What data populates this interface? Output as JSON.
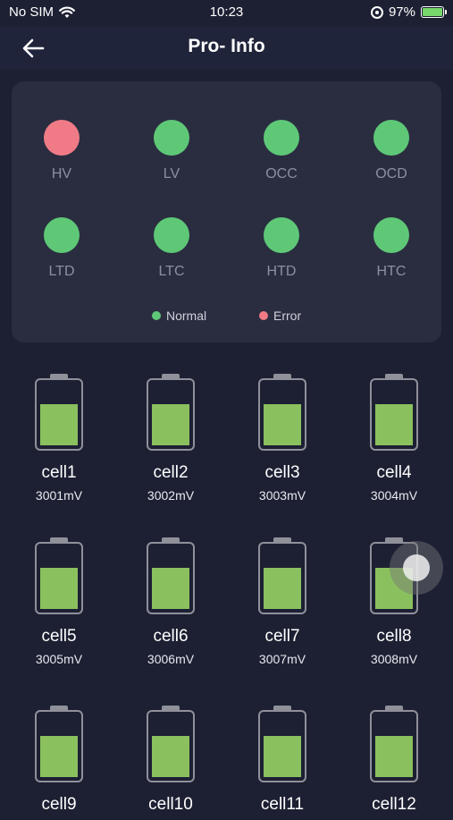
{
  "status_bar": {
    "carrier": "No SIM",
    "time": "10:23",
    "battery": "97%"
  },
  "header": {
    "title": "Pro- Info"
  },
  "protections": [
    {
      "label": "HV",
      "status": "error",
      "color": "#f07b86"
    },
    {
      "label": "LV",
      "status": "normal",
      "color": "#5ec877"
    },
    {
      "label": "OCC",
      "status": "normal",
      "color": "#5ec877"
    },
    {
      "label": "OCD",
      "status": "normal",
      "color": "#5ec877"
    },
    {
      "label": "LTD",
      "status": "normal",
      "color": "#5ec877"
    },
    {
      "label": "LTC",
      "status": "normal",
      "color": "#5ec877"
    },
    {
      "label": "HTD",
      "status": "normal",
      "color": "#5ec877"
    },
    {
      "label": "HTC",
      "status": "normal",
      "color": "#5ec877"
    }
  ],
  "legend": {
    "normal": "Normal",
    "error": "Error",
    "normal_color": "#5ec877",
    "error_color": "#f07b86"
  },
  "cells": [
    {
      "name": "cell1",
      "voltage": "3001mV",
      "level": 0.58
    },
    {
      "name": "cell2",
      "voltage": "3002mV",
      "level": 0.58
    },
    {
      "name": "cell3",
      "voltage": "3003mV",
      "level": 0.58
    },
    {
      "name": "cell4",
      "voltage": "3004mV",
      "level": 0.58
    },
    {
      "name": "cell5",
      "voltage": "3005mV",
      "level": 0.58
    },
    {
      "name": "cell6",
      "voltage": "3006mV",
      "level": 0.58
    },
    {
      "name": "cell7",
      "voltage": "3007mV",
      "level": 0.58
    },
    {
      "name": "cell8",
      "voltage": "3008mV",
      "level": 0.58
    },
    {
      "name": "cell9",
      "voltage": "",
      "level": 0.58
    },
    {
      "name": "cell10",
      "voltage": "",
      "level": 0.58
    },
    {
      "name": "cell11",
      "voltage": "",
      "level": 0.58
    },
    {
      "name": "cell12",
      "voltage": "",
      "level": 0.58
    }
  ]
}
